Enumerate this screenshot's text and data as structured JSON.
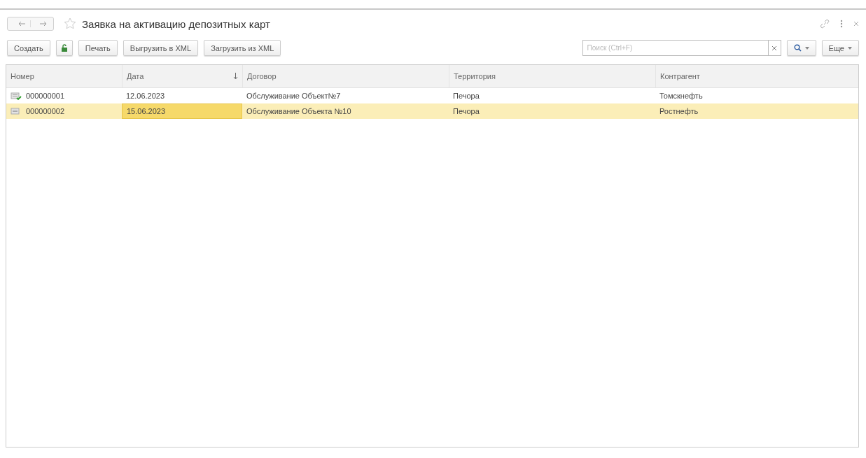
{
  "window": {
    "title": "Заявка на активацию депозитных карт",
    "favorite": false
  },
  "toolbar": {
    "buttons": [
      {
        "label": "Создать",
        "kind": "text"
      },
      {
        "kind": "icon"
      },
      {
        "label": "Печать",
        "kind": "text"
      },
      {
        "label": "Выгрузить в XML",
        "kind": "text"
      },
      {
        "label": "Загрузить из XML",
        "kind": "text"
      }
    ],
    "search": {
      "placeholder": "Поиск (Ctrl+F)"
    },
    "more": "Еще"
  },
  "table": {
    "columns": [
      {
        "label": "Номер",
        "sorted": false
      },
      {
        "label": "Дата",
        "sorted": true
      },
      {
        "label": "Договор",
        "sorted": false
      },
      {
        "label": "Территория",
        "sorted": false
      },
      {
        "label": "Контрагент",
        "sorted": false
      }
    ],
    "rows": [
      {
        "posted": true,
        "selected": false,
        "cells": [
          "000000001",
          "12.06.2023",
          "Обслуживание Объект№7",
          "Печора",
          "Томскнефть"
        ]
      },
      {
        "posted": false,
        "selected": true,
        "cells": [
          "000000002",
          "15.06.2023",
          "Обслуживание Объекта №10",
          "Печора",
          "Ростнефть"
        ]
      }
    ]
  }
}
